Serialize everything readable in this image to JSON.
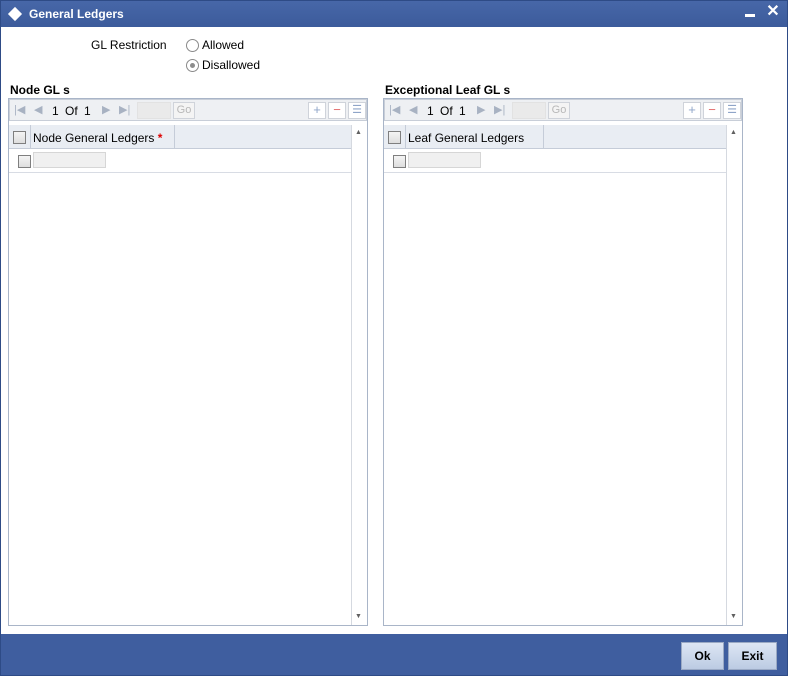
{
  "window": {
    "title": "General Ledgers",
    "minimize_icon": "minimize-icon",
    "close_glyph": "✕"
  },
  "restriction": {
    "label": "GL Restriction",
    "options": [
      {
        "label": "Allowed",
        "selected": false
      },
      {
        "label": "Disallowed",
        "selected": true
      }
    ]
  },
  "node_panel": {
    "title": "Node GL s",
    "pagination": {
      "current": "1",
      "of_label": "Of",
      "total": "1",
      "go_label": "Go"
    },
    "column": "Node General Ledgers",
    "required_mark": "*"
  },
  "leaf_panel": {
    "title": "Exceptional Leaf GL s",
    "pagination": {
      "current": "1",
      "of_label": "Of",
      "total": "1",
      "go_label": "Go"
    },
    "column": "Leaf General Ledgers"
  },
  "footer": {
    "ok_label": "Ok",
    "exit_label": "Exit"
  }
}
